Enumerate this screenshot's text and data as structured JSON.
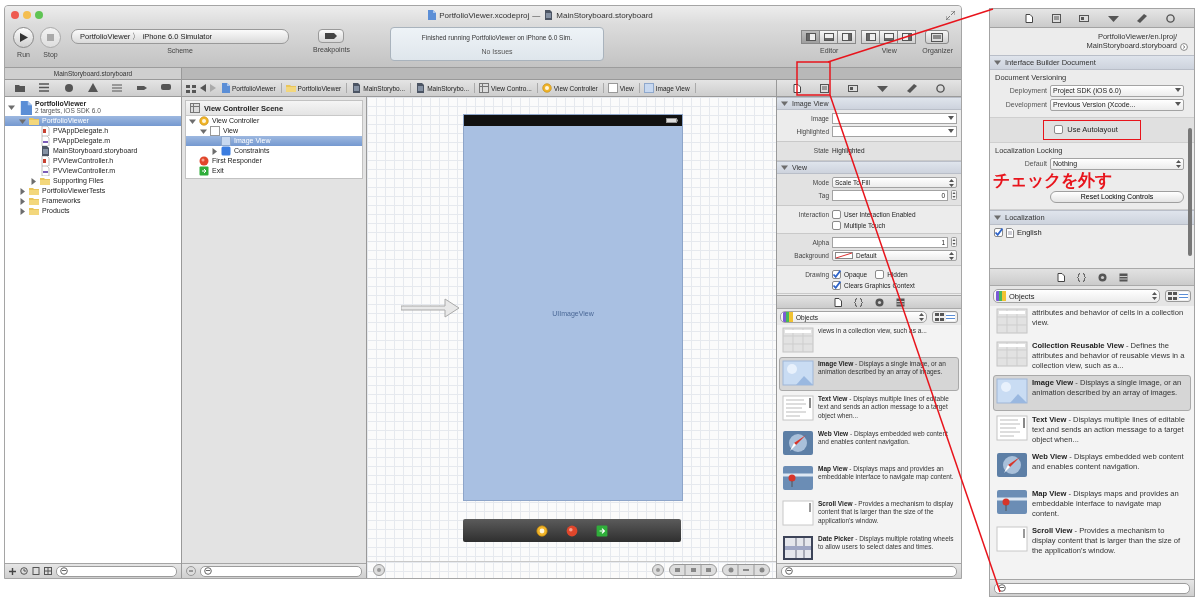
{
  "window": {
    "title": "PortfolioViewer.xcodeproj",
    "separator": "—",
    "subtitle": "MainStoryboard.storyboard"
  },
  "toolbar": {
    "run": "Run",
    "stop": "Stop",
    "scheme": "PortfolioViewer 〉 iPhone 6.0 Simulator",
    "scheme_label": "Scheme",
    "breakpoints": "Breakpoints",
    "activity": "Finished running PortfolioViewer on iPhone 6.0 Sim.",
    "issues": "No Issues",
    "editor": "Editor",
    "view": "View",
    "organizer": "Organizer"
  },
  "tab": "MainStoryboard.storyboard",
  "jump_bar": [
    {
      "label": "PortfolioViewer",
      "kind": "project"
    },
    {
      "label": "PortfolioViewer",
      "kind": "folder"
    },
    {
      "label": "MainStorybo...",
      "kind": "storyboard"
    },
    {
      "label": "MainStorybo...",
      "kind": "storyboard"
    },
    {
      "label": "View Contro...",
      "kind": "scene"
    },
    {
      "label": "View Controller",
      "kind": "controller"
    },
    {
      "label": "View",
      "kind": "view"
    },
    {
      "label": "Image View",
      "kind": "imageview"
    }
  ],
  "navigator": [
    {
      "label": "PortfolioViewer",
      "subtitle": "2 targets, iOS SDK 6.0",
      "kind": "project",
      "expanded": true,
      "selected": false,
      "children": [
        {
          "label": "PortfolioViewer",
          "kind": "folder",
          "expanded": true,
          "selected": true,
          "children": [
            {
              "label": "PVAppDelegate.h",
              "kind": "header",
              "selected": false
            },
            {
              "label": "PVAppDelegate.m",
              "kind": "impl",
              "selected": false
            },
            {
              "label": "MainStoryboard.storyboard",
              "kind": "storyboard",
              "selected": false
            },
            {
              "label": "PVViewController.h",
              "kind": "header",
              "selected": false
            },
            {
              "label": "PVViewController.m",
              "kind": "impl",
              "selected": false
            },
            {
              "label": "Supporting Files",
              "kind": "folder",
              "expanded": false,
              "selected": false
            }
          ]
        },
        {
          "label": "PortfolioViewerTests",
          "kind": "folder",
          "expanded": false,
          "selected": false
        },
        {
          "label": "Frameworks",
          "kind": "folder",
          "expanded": false,
          "selected": false
        },
        {
          "label": "Products",
          "kind": "folder",
          "expanded": false,
          "selected": false
        }
      ]
    }
  ],
  "outline": {
    "title": "View Controller Scene",
    "items": [
      {
        "label": "View Controller",
        "kind": "controller",
        "expanded": true,
        "selected": false,
        "children": [
          {
            "label": "View",
            "kind": "view",
            "expanded": true,
            "selected": false,
            "children": [
              {
                "label": "Image View",
                "kind": "imageview",
                "selected": true
              },
              {
                "label": "Constraints",
                "kind": "constraints",
                "expanded": false,
                "selected": false
              }
            ]
          }
        ]
      },
      {
        "label": "First Responder",
        "kind": "responder",
        "selected": false
      },
      {
        "label": "Exit",
        "kind": "exit",
        "selected": false
      }
    ]
  },
  "canvas": {
    "view_label": "UIImageView"
  },
  "inspector": {
    "sections": [
      {
        "title": "Image View",
        "expanded": true,
        "groups": [
          [
            {
              "kind": "combo",
              "label": "Image"
            },
            {
              "kind": "combo",
              "label": "Highlighted"
            }
          ],
          [
            {
              "kind": "text",
              "label": "State",
              "value": "Highlighted"
            }
          ]
        ]
      },
      {
        "title": "View",
        "expanded": true,
        "groups": [
          [
            {
              "kind": "popup",
              "label": "Mode",
              "value": "Scale To Fill"
            },
            {
              "kind": "stepper",
              "label": "Tag",
              "value": "0"
            }
          ],
          [
            {
              "kind": "checks",
              "label": "Interaction",
              "checks": [
                {
                  "label": "User Interaction Enabled",
                  "checked": false
                },
                {
                  "label": "Multiple Touch",
                  "checked": false
                }
              ]
            }
          ],
          [
            {
              "kind": "stepper",
              "label": "Alpha",
              "value": "1"
            },
            {
              "kind": "color",
              "label": "Background",
              "value": "Default"
            }
          ],
          [
            {
              "kind": "checks",
              "label": "Drawing",
              "checks": [
                {
                  "label": "Opaque",
                  "checked": true
                },
                {
                  "label": "Hidden",
                  "checked": false
                },
                {
                  "label": "Clears Graphics Context",
                  "checked": true
                }
              ]
            }
          ]
        ]
      }
    ]
  },
  "library": {
    "filter": "Objects",
    "view_modes": [
      {
        "kind": "grid",
        "selected": false
      },
      {
        "kind": "list",
        "selected": true
      }
    ],
    "items": [
      {
        "kind": "collection",
        "text": "views in a collection view, such as a...",
        "selected": false
      },
      {
        "kind": "image",
        "text": "**Image View** - Displays a single image, or an animation described by an array of images.",
        "selected": true
      },
      {
        "kind": "text",
        "text": "**Text View** - Displays multiple lines of editable text and sends an action message to a target object when...",
        "selected": false
      },
      {
        "kind": "web",
        "text": "**Web View** - Displays embedded web content and enables content navigation.",
        "selected": false
      },
      {
        "kind": "map",
        "text": "**Map View** - Displays maps and provides an embeddable interface to navigate map content.",
        "selected": false
      },
      {
        "kind": "scroll",
        "text": "**Scroll View** - Provides a mechanism to display content that is larger than the size of the application's window.",
        "selected": false
      },
      {
        "kind": "picker",
        "text": "**Date Picker** - Displays multiple rotating wheels to allow users to select dates and times.",
        "selected": false
      }
    ]
  },
  "detail": {
    "path": [
      "PortfolioViewer/en.lproj/",
      "MainStoryboard.storyboard"
    ],
    "document_section": {
      "title": "Interface Builder Document",
      "expanded": true,
      "versioning": "Document Versioning",
      "deployment": {
        "label": "Deployment",
        "value": "Project SDK (iOS 6.0)"
      },
      "development": {
        "label": "Development",
        "value": "Previous Version (Xcode..."
      },
      "autolayout": {
        "label": "Use Autolayout",
        "checked": false
      },
      "locking": "Localization Locking",
      "default": {
        "label": "Default",
        "value": "Nothing"
      },
      "reset": "Reset Locking Controls"
    },
    "callout": "チェックを外す",
    "localization_section": {
      "title": "Localization",
      "expanded": true,
      "languages": [
        {
          "label": "English",
          "checked": true
        }
      ]
    },
    "library": {
      "filter": "Objects",
      "view_modes": [
        {
          "kind": "grid",
          "selected": false
        },
        {
          "kind": "list",
          "selected": true
        }
      ],
      "items": [
        {
          "kind": "collection",
          "text": "attributes and behavior of cells in a collection view.",
          "selected": false
        },
        {
          "kind": "collection",
          "text": "**Collection Reusable View** - Defines the attributes and behavior of reusable views in a collection view, such as a...",
          "selected": false
        },
        {
          "kind": "image",
          "text": "**Image View** - Displays a single image, or an animation described by an array of images.",
          "selected": true
        },
        {
          "kind": "text",
          "text": "**Text View** - Displays multiple lines of editable text and sends an action message to a target object when...",
          "selected": false
        },
        {
          "kind": "web",
          "text": "**Web View** - Displays embedded web content and enables content navigation.",
          "selected": false
        },
        {
          "kind": "map",
          "text": "**Map View** - Displays maps and provides an embeddable interface to navigate map content.",
          "selected": false
        },
        {
          "kind": "scroll",
          "text": "**Scroll View** - Provides a mechanism to display content that is larger than the size of the application's window.",
          "selected": false
        }
      ]
    }
  }
}
